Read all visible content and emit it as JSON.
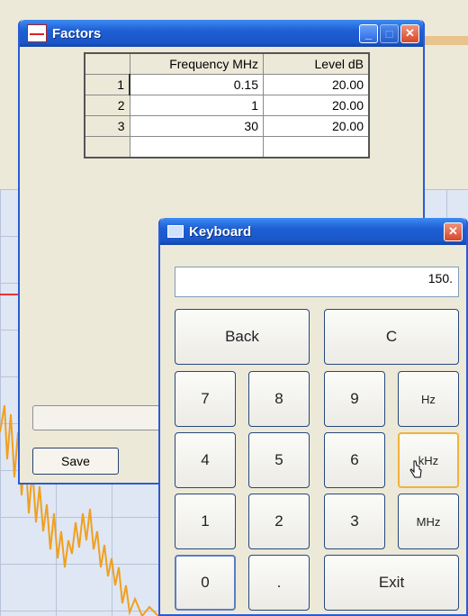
{
  "factors": {
    "title": "Factors",
    "icon": "factors-app-icon",
    "controls": {
      "minimize": "_",
      "maximize": "□",
      "close": "✕"
    },
    "table": {
      "headers": [
        "",
        "Frequency MHz",
        "Level dB"
      ],
      "rows": [
        {
          "index": "1",
          "frequency": "0.15",
          "level": "20.00"
        },
        {
          "index": "2",
          "frequency": "1",
          "level": "20.00"
        },
        {
          "index": "3",
          "frequency": "30",
          "level": "20.00"
        },
        {
          "index": "",
          "frequency": "",
          "level": ""
        }
      ]
    },
    "save_label": "Save"
  },
  "keyboard": {
    "title": "Keyboard",
    "close": "✕",
    "display_value": "150.",
    "keys": {
      "back": "Back",
      "clear": "C",
      "k7": "7",
      "k8": "8",
      "k9": "9",
      "hz": "Hz",
      "k4": "4",
      "k5": "5",
      "k6": "6",
      "khz": "kHz",
      "k1": "1",
      "k2": "2",
      "k3": "3",
      "mhz": "MHz",
      "k0": "0",
      "dot": ".",
      "exit": "Exit"
    }
  },
  "colors": {
    "titlebar": "#1e5fd4",
    "trace": "#f0a020",
    "marker": "#e33333"
  }
}
